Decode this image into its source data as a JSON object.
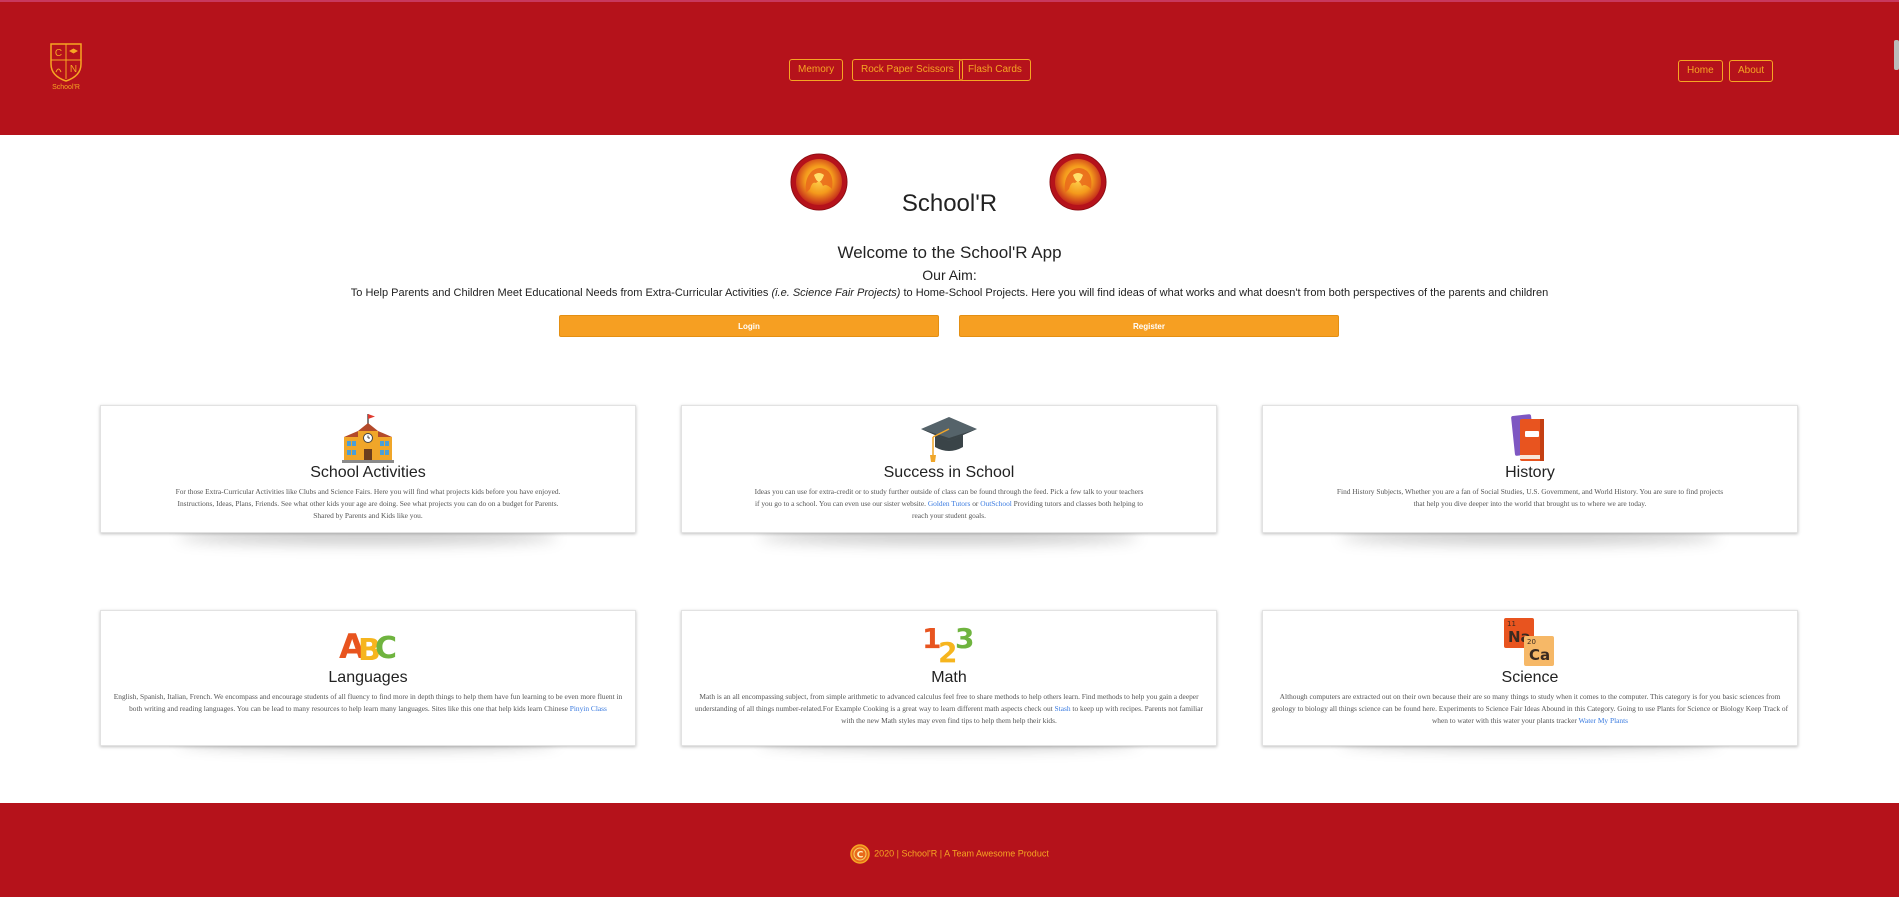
{
  "header": {
    "logo": {
      "text": "School'R",
      "letters": [
        "C",
        "N"
      ]
    },
    "game_links": [
      {
        "label": "Memory"
      },
      {
        "label": "Rock Paper Scissors"
      },
      {
        "label": "Flash Cards"
      }
    ],
    "site_links": [
      {
        "label": "Home"
      },
      {
        "label": "About"
      }
    ],
    "colors": {
      "header_bg": "#b5121b",
      "accent": "#f6a623"
    }
  },
  "hero": {
    "title": "School'R",
    "welcome": "Welcome to the School'R App",
    "aim_heading": "Our Aim:",
    "aim_text_before": "To Help Parents and Children Meet Educational Needs from Extra-Curricular Activities ",
    "aim_text_em": "(i.e. Science Fair Projects)",
    "aim_text_after": " to Home-School Projects. Here you will find ideas of what works and what doesn't from both perspectives of the parents and children",
    "login_label": "Login",
    "register_label": "Register",
    "button_color": "#f69f22"
  },
  "cards": [
    {
      "title": "School Activities",
      "icon": "school-building-icon",
      "text": "For those Extra-Curricular Activities like Clubs and Science Fairs. Here you will find what projects kids before you have enjoyed. Instructions, Ideas, Plans, Friends. See what other kids your age are doing. See what projects you can do on a budget for Parents. Shared by Parents and Kids like you."
    },
    {
      "title": "Success in School",
      "icon": "graduation-cap-icon",
      "text_before": "Ideas you can use for extra-credit or to study further outside of class can be found through the feed. Pick a few talk to your teachers if you go to a school. You can even use our sister website. ",
      "link1": "Golden Tutors",
      "text_mid": " or ",
      "link2": "OutSchool",
      "text_after": " Providing tutors and classes both helping to reach your student goals."
    },
    {
      "title": "History",
      "icon": "books-icon",
      "text": "Find History Subjects, Whether you are a fan of Social Studies, U.S. Government, and World History. You are sure to find projects that help you dive deeper into the world that brought us to where we are today."
    },
    {
      "title": "Languages",
      "icon": "abc-icon",
      "text_before": "English, Spanish, Italian, French. We encompass and encourage students of all fluency to find more in depth things to help them have fun learning to be even more fluent in both writing and reading languages. You can be lead to many resources to help learn many languages. Sites like this one that help kids learn Chinese ",
      "link1": "Pinyin Class"
    },
    {
      "title": "Math",
      "icon": "numbers-123-icon",
      "text_before": "Math is an all encompassing subject, from simple arithmetic to advanced calculus feel free to share methods to help others learn. Find methods to help you gain a deeper understanding of all things number-related.For Example Cooking is a great way to learn different math aspects check out ",
      "link1": "Stash",
      "text_after": " to keep up with recipes. Parents not familiar with the new Math styles may even find tips to help them help their kids."
    },
    {
      "title": "Science",
      "icon": "periodic-elements-icon",
      "text_before": "Although computers are extracted out on their own because their are so many things to study when it comes to the computer. This category is for you basic sciences from geology to biology all things science can be found here. Experiments to Science Fair Ideas Abound in this Category. Going to use Plants for Science or Biology Keep Track of when to water with this water your plants tracker ",
      "link1": "Water My Plants",
      "elements": [
        {
          "number": "11",
          "symbol": "Na"
        },
        {
          "number": "20",
          "symbol": "Ca"
        }
      ]
    }
  ],
  "footer": {
    "text": "2020 | School'R | A Team Awesome Product",
    "icon": "c-coin-icon"
  }
}
